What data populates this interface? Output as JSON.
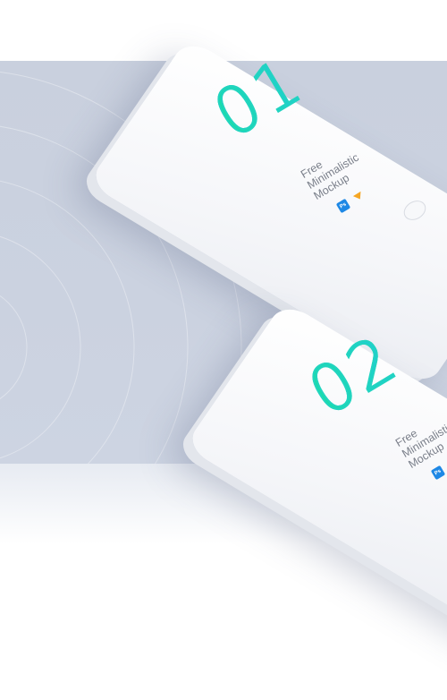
{
  "mockups": [
    {
      "number": "01",
      "caption": [
        "Free",
        "Minimalistic",
        "Mockup"
      ],
      "badge": "Ps"
    },
    {
      "number": "02",
      "caption": [
        "Free",
        "Minimalistic",
        "Mockup"
      ],
      "badge": "Ps"
    }
  ],
  "colors": {
    "backdrop": "#c9d0de",
    "numeral_gradient_start": "#19e0a0",
    "numeral_gradient_end": "#1fc8e0",
    "caption": "#7a7f8a",
    "ps_badge": "#1e88e5",
    "sketch_icon": "#f5a623"
  },
  "icons": [
    "photoshop-badge-icon",
    "sketch-icon",
    "home-button-icon"
  ]
}
